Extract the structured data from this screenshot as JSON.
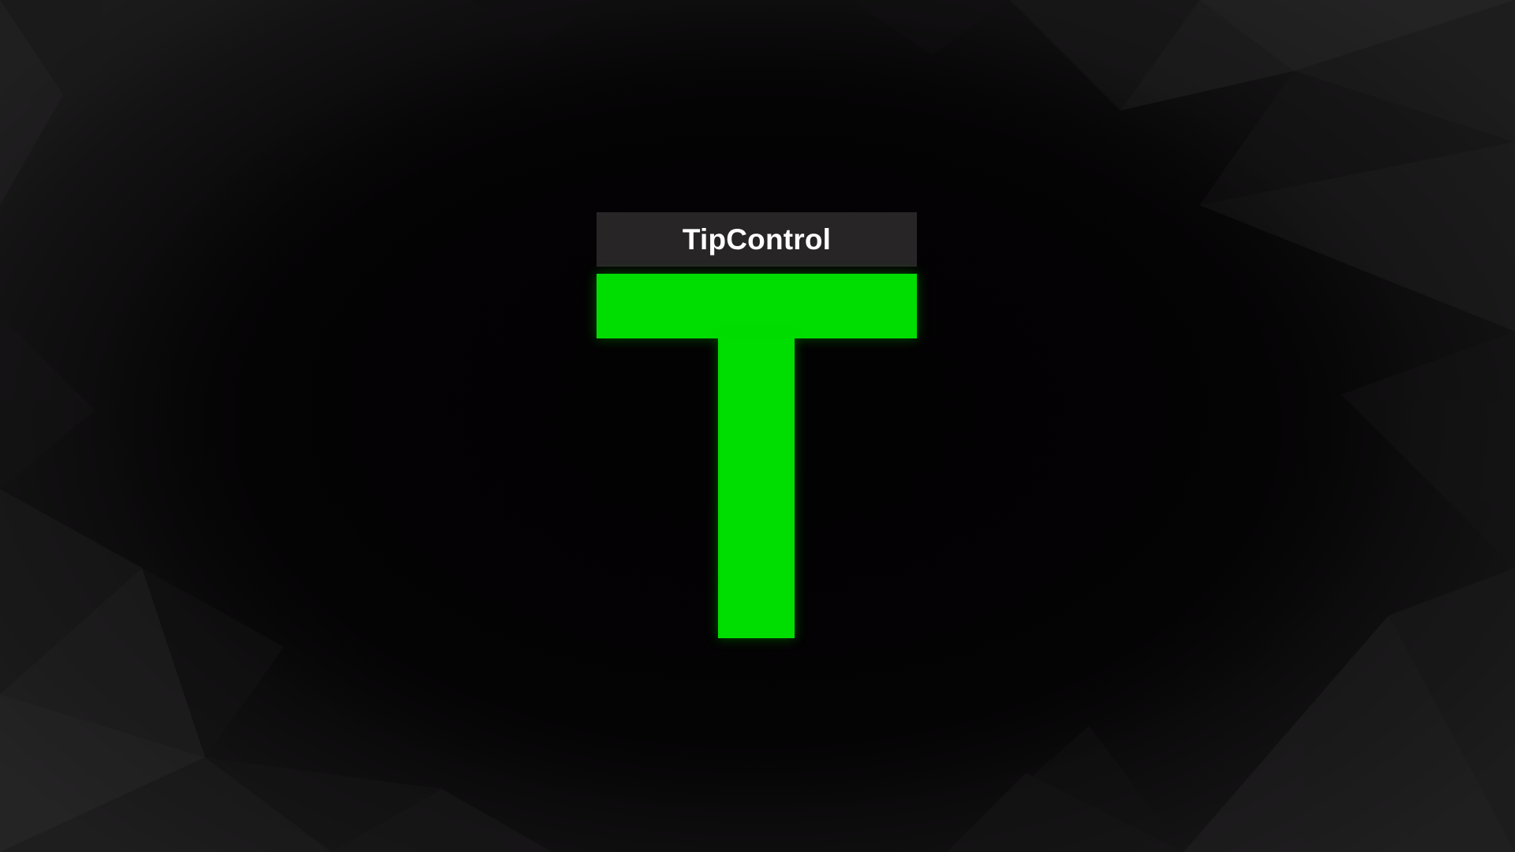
{
  "title": "TipControl",
  "colors": {
    "brand_green": "#00dd00",
    "title_bar": "#272526",
    "background": "#050405"
  }
}
